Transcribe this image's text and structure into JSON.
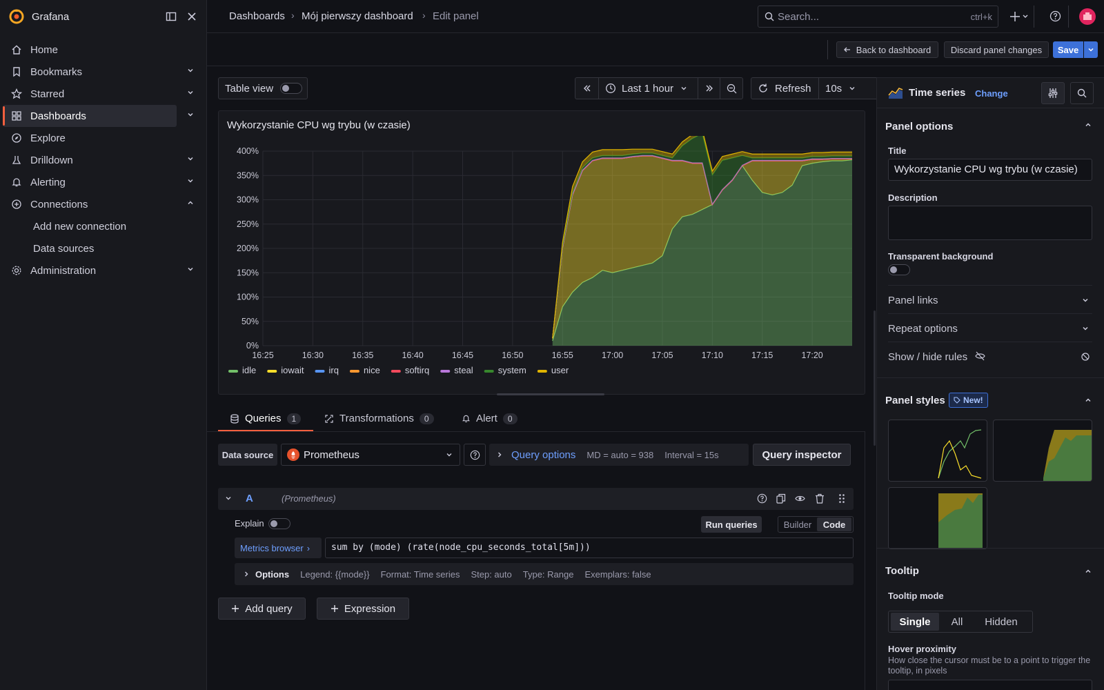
{
  "app": {
    "name": "Grafana"
  },
  "sidebar": {
    "items": [
      {
        "label": "Home"
      },
      {
        "label": "Bookmarks"
      },
      {
        "label": "Starred"
      },
      {
        "label": "Dashboards"
      },
      {
        "label": "Explore"
      },
      {
        "label": "Drilldown"
      },
      {
        "label": "Alerting"
      },
      {
        "label": "Connections"
      },
      {
        "label": "Add new connection"
      },
      {
        "label": "Data sources"
      },
      {
        "label": "Administration"
      }
    ]
  },
  "breadcrumb": {
    "items": [
      "Dashboards",
      "Mój pierwszy dashboard",
      "Edit panel"
    ]
  },
  "search": {
    "placeholder": "Search...",
    "shortcut": "ctrl+k"
  },
  "edit_toolbar": {
    "back": "Back to dashboard",
    "discard": "Discard panel changes",
    "save": "Save"
  },
  "panel_toolbar": {
    "table_view": "Table view",
    "time_range": "Last 1 hour",
    "refresh": "Refresh",
    "refresh_interval": "10s"
  },
  "panel": {
    "title": "Wykorzystanie CPU wg trybu (w czasie)"
  },
  "chart_data": {
    "type": "area",
    "title": "Wykorzystanie CPU wg trybu (w czasie)",
    "x_ticks": [
      "16:25",
      "16:30",
      "16:35",
      "16:40",
      "16:45",
      "16:50",
      "16:55",
      "17:00",
      "17:05",
      "17:10",
      "17:15",
      "17:20"
    ],
    "y_ticks": [
      "0%",
      "50%",
      "100%",
      "150%",
      "200%",
      "250%",
      "300%",
      "350%",
      "400%"
    ],
    "ylim": [
      0,
      400
    ],
    "stacked": true,
    "x": [
      "16:54",
      "16:55",
      "16:56",
      "16:57",
      "16:58",
      "16:59",
      "17:00",
      "17:01",
      "17:02",
      "17:03",
      "17:04",
      "17:05",
      "17:06",
      "17:07",
      "17:08",
      "17:09",
      "17:10",
      "17:11",
      "17:12",
      "17:13",
      "17:14",
      "17:15",
      "17:16",
      "17:17",
      "17:18",
      "17:19",
      "17:20",
      "17:21",
      "17:22",
      "17:23",
      "17:24"
    ],
    "series": [
      {
        "name": "idle",
        "color": "#73bf69",
        "values": [
          10,
          80,
          110,
          130,
          140,
          155,
          150,
          155,
          160,
          165,
          170,
          185,
          240,
          265,
          270,
          280,
          290,
          320,
          340,
          370,
          340,
          315,
          310,
          315,
          330,
          370,
          375,
          378,
          380,
          380,
          382
        ]
      },
      {
        "name": "iowait",
        "color": "#fade2a",
        "values": [
          5,
          120,
          200,
          230,
          240,
          230,
          235,
          230,
          228,
          225,
          220,
          200,
          140,
          115,
          105,
          95,
          0,
          0,
          0,
          0,
          40,
          65,
          70,
          65,
          50,
          10,
          8,
          5,
          4,
          4,
          2
        ]
      },
      {
        "name": "irq",
        "color": "#5794f2",
        "values": [
          0,
          0,
          0,
          0,
          0,
          0,
          0,
          0,
          0,
          0,
          0,
          0,
          0,
          0,
          0,
          0,
          0,
          0,
          0,
          0,
          0,
          0,
          0,
          0,
          0,
          0,
          0,
          0,
          0,
          0,
          0
        ]
      },
      {
        "name": "nice",
        "color": "#ff9830",
        "values": [
          0,
          0,
          0,
          0,
          0,
          0,
          0,
          0,
          0,
          0,
          0,
          0,
          0,
          0,
          0,
          0,
          0,
          0,
          0,
          0,
          0,
          0,
          0,
          0,
          0,
          0,
          0,
          0,
          0,
          0,
          0
        ]
      },
      {
        "name": "softirq",
        "color": "#f2495c",
        "values": [
          0,
          0,
          0,
          0,
          0,
          0,
          0,
          0,
          0,
          0,
          0,
          0,
          0,
          0,
          0,
          0,
          0,
          0,
          0,
          0,
          0,
          0,
          0,
          0,
          0,
          0,
          0,
          0,
          0,
          0,
          0
        ]
      },
      {
        "name": "steal",
        "color": "#b877d9",
        "values": [
          0,
          1,
          1,
          1,
          1,
          1,
          1,
          1,
          1,
          1,
          1,
          1,
          1,
          1,
          1,
          1,
          1,
          1,
          1,
          1,
          1,
          1,
          1,
          1,
          1,
          1,
          1,
          1,
          1,
          1,
          1
        ]
      },
      {
        "name": "system",
        "color": "#37872d",
        "values": [
          0,
          3,
          4,
          5,
          5,
          5,
          5,
          5,
          5,
          5,
          5,
          5,
          5,
          30,
          50,
          60,
          60,
          60,
          45,
          20,
          5,
          5,
          5,
          5,
          5,
          5,
          5,
          5,
          5,
          5,
          5
        ]
      },
      {
        "name": "user",
        "color": "#e0b400",
        "values": [
          0,
          8,
          12,
          12,
          12,
          12,
          12,
          12,
          10,
          8,
          8,
          8,
          8,
          8,
          8,
          8,
          8,
          8,
          8,
          8,
          8,
          8,
          8,
          8,
          8,
          8,
          8,
          8,
          8,
          8,
          8
        ]
      }
    ],
    "legend": "bottom",
    "grid": true
  },
  "tabs": [
    {
      "label": "Queries",
      "count": "1"
    },
    {
      "label": "Transformations",
      "count": "0"
    },
    {
      "label": "Alert",
      "count": "0"
    }
  ],
  "datasource": {
    "label": "Data source",
    "value": "Prometheus",
    "query_options": "Query options",
    "md": "MD = auto = 938",
    "interval": "Interval = 15s",
    "inspector": "Query inspector"
  },
  "query": {
    "ref": "A",
    "ds_tag": "(Prometheus)",
    "explain": "Explain",
    "run": "Run queries",
    "builder": "Builder",
    "code": "Code",
    "metrics_browser": "Metrics browser",
    "expr": "sum by (mode) (rate(node_cpu_seconds_total[5m]))",
    "options_label": "Options",
    "opt_legend": "Legend: {{mode}}",
    "opt_format": "Format: Time series",
    "opt_step": "Step: auto",
    "opt_type": "Type: Range",
    "opt_exemplars": "Exemplars: false"
  },
  "actions": {
    "add_query": "Add query",
    "expression": "Expression"
  },
  "rightpane": {
    "viz_name": "Time series",
    "change": "Change",
    "panel_options": "Panel options",
    "title_label": "Title",
    "title_value": "Wykorzystanie CPU wg trybu (w czasie)",
    "description_label": "Description",
    "transparent_label": "Transparent background",
    "panel_links": "Panel links",
    "repeat_options": "Repeat options",
    "show_hide_rules": "Show / hide rules",
    "panel_styles": "Panel styles",
    "new_badge": "New!",
    "tooltip": "Tooltip",
    "tooltip_mode": "Tooltip mode",
    "mode_single": "Single",
    "mode_all": "All",
    "mode_hidden": "Hidden",
    "hover_proximity": "Hover proximity",
    "hover_desc": "How close the cursor must be to a point to trigger the tooltip, in pixels"
  }
}
